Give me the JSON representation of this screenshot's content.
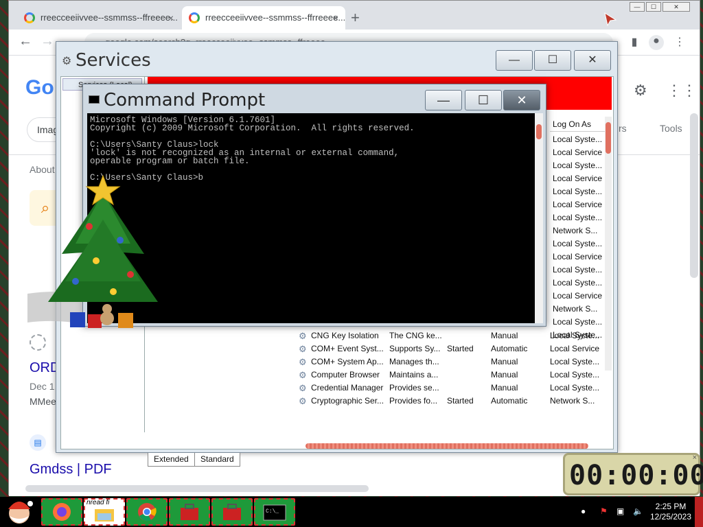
{
  "browser": {
    "tabs": [
      {
        "label": "rreecceeiivvee--ssmmss--ffreeee...",
        "active": false
      },
      {
        "label": "rreecceeiivvee--ssmmss--ffrreeee...",
        "active": true
      }
    ],
    "tab_close": "×",
    "new_tab": "+",
    "url": "google.com/search?q=rreecceeiivvee--ssmmss--ffreeee",
    "page": {
      "logo": "Go",
      "chip_images": "Imag",
      "about": "About",
      "tools": "Tools",
      "rs": "rs",
      "result1": {
        "title": "ORD",
        "date": "Dec 1,",
        "snippet": "MMee"
      },
      "result2": {
        "title": "Gmdss | PDF"
      }
    }
  },
  "services": {
    "title": "Services",
    "tree_root": "Services (Local)",
    "logon_header": "Log On As",
    "logon_column": [
      "Local Syste...",
      "Local Service",
      "Local Syste...",
      "Local Service",
      "Local Syste...",
      "Local Service",
      "Local Syste...",
      "Network S...",
      "Local Syste...",
      "Local Service",
      "Local Syste...",
      "Local Syste...",
      "Local Service",
      "Network S...",
      "Local Syste...",
      "Local Syste..."
    ],
    "rows": [
      {
        "name": "CNG Key Isolation",
        "desc": "The CNG ke...",
        "status": "",
        "startup": "Manual",
        "logon": "Local Syste..."
      },
      {
        "name": "COM+ Event Syst...",
        "desc": "Supports Sy...",
        "status": "Started",
        "startup": "Automatic",
        "logon": "Local Service"
      },
      {
        "name": "COM+ System Ap...",
        "desc": "Manages th...",
        "status": "",
        "startup": "Manual",
        "logon": "Local Syste..."
      },
      {
        "name": "Computer Browser",
        "desc": "Maintains a...",
        "status": "",
        "startup": "Manual",
        "logon": "Local Syste..."
      },
      {
        "name": "Credential Manager",
        "desc": "Provides se...",
        "status": "",
        "startup": "Manual",
        "logon": "Local Syste..."
      },
      {
        "name": "Cryptographic Ser...",
        "desc": "Provides fo...",
        "status": "Started",
        "startup": "Automatic",
        "logon": "Network S..."
      }
    ],
    "tabs": [
      "Extended",
      "Standard"
    ]
  },
  "cmd": {
    "title": "Command Prompt",
    "output": "Microsoft Windows [Version 6.1.7601]\nCopyright (c) 2009 Microsoft Corporation.  All rights reserved.\n\nC:\\Users\\Santy Claus>lock\n'lock' is not recognized as an internal or external command,\noperable program or batch file.\n\nC:\\Users\\Santy Claus>b"
  },
  "window_buttons": {
    "minimize": "—",
    "maximize": "☐",
    "close": "✕"
  },
  "countdown": {
    "display": "00:00:00",
    "close": "×"
  },
  "taskbar": {
    "time": "2:25 PM",
    "date": "12/25/2023",
    "items": [
      "firefox",
      "unread-file",
      "chrome",
      "toolbox",
      "toolbox",
      "cmd"
    ],
    "unread_caption": "nread fi"
  },
  "colors": {
    "accent_red": "#ff0000",
    "scroll_thumb": "#e07060",
    "taskbar_item": "#1e9a3a",
    "countdown_bg": "#d9d6a8"
  }
}
